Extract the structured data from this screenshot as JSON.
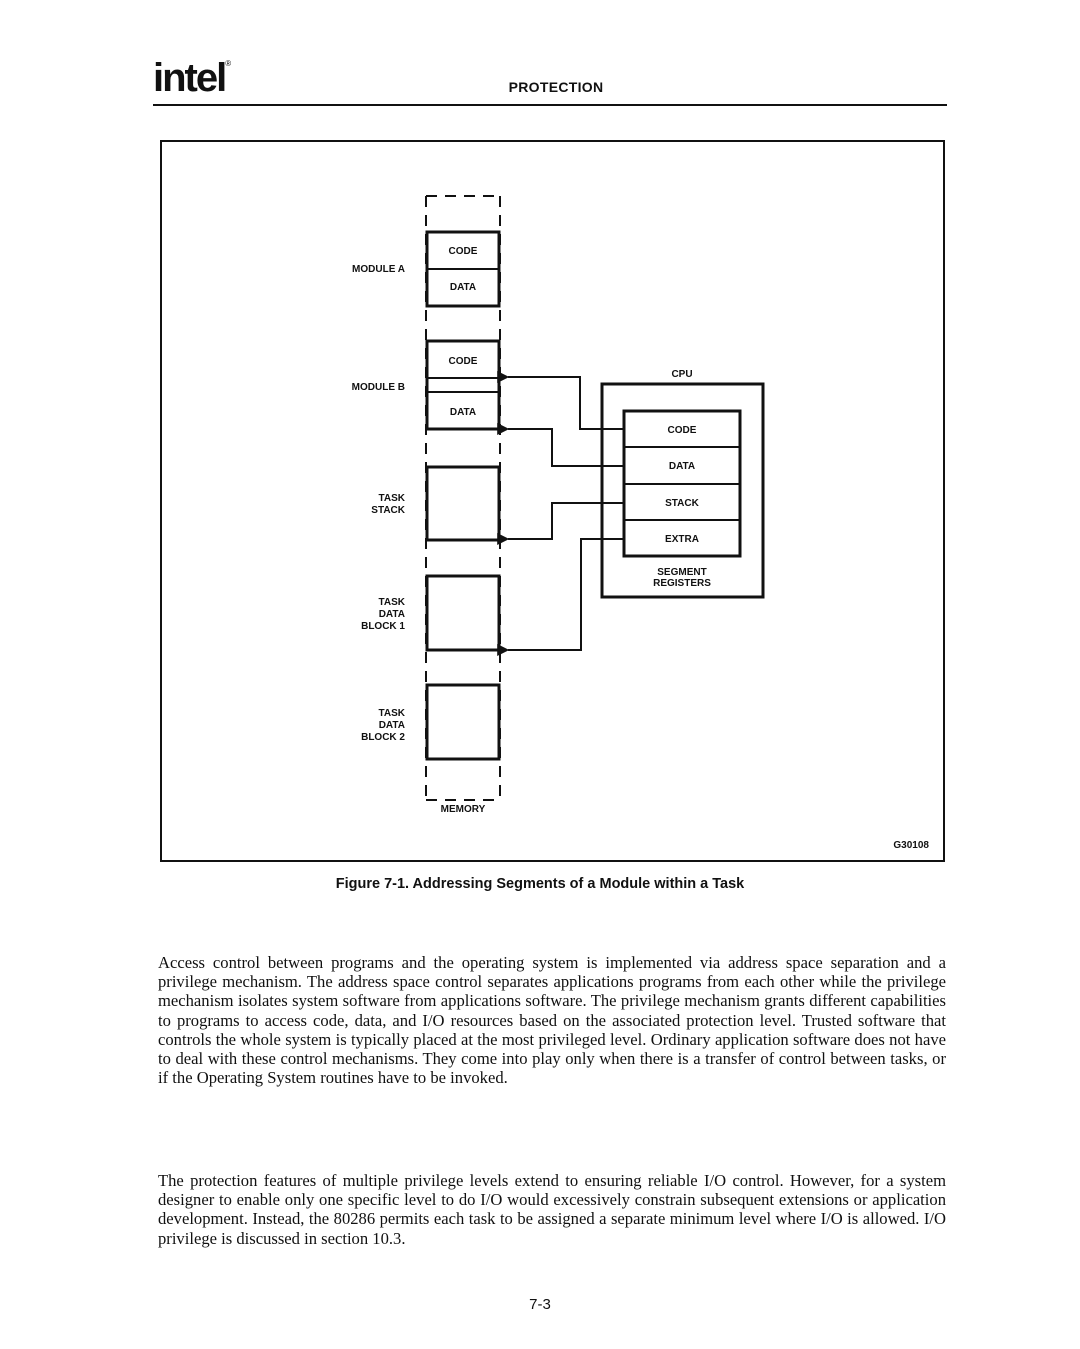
{
  "header": {
    "logo": "intel",
    "logo_mark": "®",
    "section_title": "PROTECTION"
  },
  "figure": {
    "memory_label": "MEMORY",
    "figure_id": "G30108",
    "caption": "Figure 7-1.  Addressing Segments of a Module within a Task",
    "module_a": {
      "label": "MODULE A",
      "segments": [
        "CODE",
        "DATA"
      ]
    },
    "module_b": {
      "label": "MODULE B",
      "segments": [
        "CODE",
        "DATA"
      ]
    },
    "task_stack": {
      "label_lines": [
        "TASK",
        "STACK"
      ]
    },
    "task_data_block_1": {
      "label_lines": [
        "TASK",
        "DATA",
        "BLOCK 1"
      ]
    },
    "task_data_block_2": {
      "label_lines": [
        "TASK",
        "DATA",
        "BLOCK 2"
      ]
    },
    "cpu": {
      "label": "CPU",
      "registers": [
        "CODE",
        "DATA",
        "STACK",
        "EXTRA"
      ],
      "registers_label_lines": [
        "SEGMENT",
        "REGISTERS"
      ]
    },
    "connections": [
      {
        "from": "CODE",
        "to": "Module B code segment"
      },
      {
        "from": "DATA",
        "to": "Module B data segment"
      },
      {
        "from": "STACK",
        "to": "Task stack"
      },
      {
        "from": "EXTRA",
        "to": "Task data block 1"
      }
    ]
  },
  "body": {
    "paragraphs": [
      "Access control between programs and the operating system is implemented via address space separation and a privilege mechanism. The address space control separates applications programs from each other while the privilege mechanism isolates system software from applications software. The privilege mechanism grants different capabilities to programs to access code, data, and I/O resources based on the associated protection level. Trusted software that controls the whole system is typically placed at the most privileged level. Ordinary application software does not have to deal with these control mechanisms. They come into play only when there is a transfer of control between tasks, or if the Operating System routines have to be invoked.",
      "The protection features of multiple privilege levels extend to ensuring reliable I/O control. However, for a system designer to enable only one specific level to do I/O would excessively constrain subsequent extensions or application development. Instead, the 80286 permits each task to be assigned a separate minimum level where I/O is allowed. I/O privilege is discussed in section 10.3."
    ]
  },
  "footer": {
    "page_number": "7-3"
  }
}
